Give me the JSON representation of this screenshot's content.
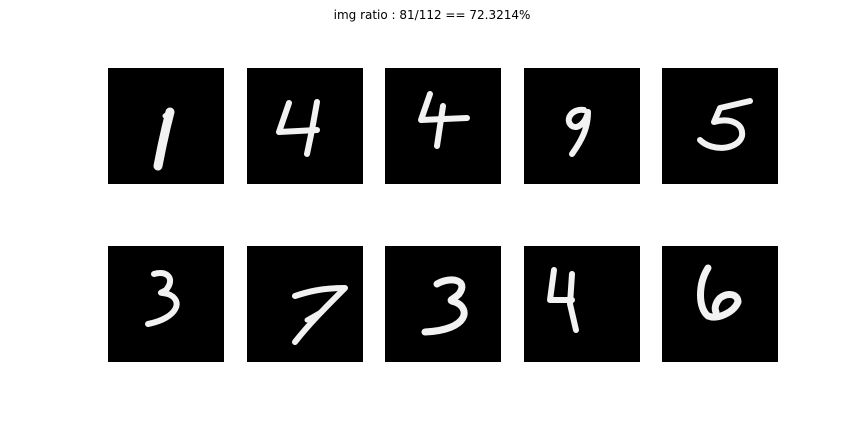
{
  "figure": {
    "title": "img ratio : 81/112 == 72.3214%"
  },
  "digits": [
    {
      "label": "1"
    },
    {
      "label": "4"
    },
    {
      "label": "4"
    },
    {
      "label": "9"
    },
    {
      "label": "5"
    },
    {
      "label": "3"
    },
    {
      "label": "7"
    },
    {
      "label": "3"
    },
    {
      "label": "4"
    },
    {
      "label": "6"
    }
  ]
}
